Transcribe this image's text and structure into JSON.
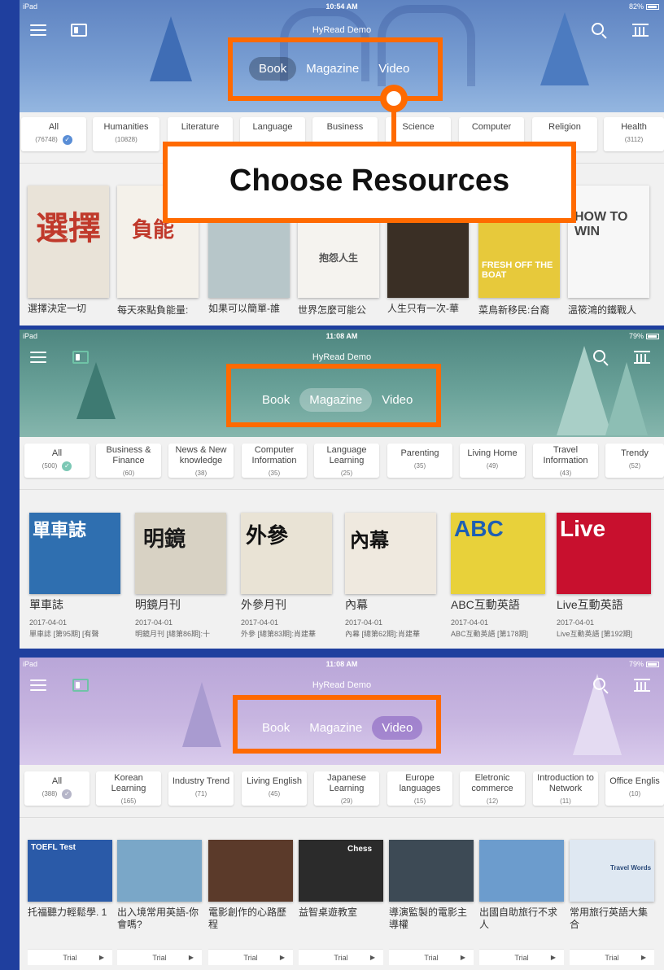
{
  "colors": {
    "accent": "#ff6a00",
    "background": "#1f3f9e"
  },
  "callout": {
    "label": "Choose Resources"
  },
  "panels": [
    {
      "status": {
        "left": "iPad",
        "time": "10:54 AM",
        "battery": "82%"
      },
      "app_name": "HyRead Demo",
      "tabs": [
        "Book",
        "Magazine",
        "Video"
      ],
      "active_tab": "Book",
      "categories": [
        {
          "label": "All",
          "count": "(76748)"
        },
        {
          "label": "Humanities",
          "count": "(10828)"
        },
        {
          "label": "Literature",
          "count": ""
        },
        {
          "label": "Language",
          "count": ""
        },
        {
          "label": "Business",
          "count": ""
        },
        {
          "label": "Science",
          "count": ""
        },
        {
          "label": "Computer",
          "count": ""
        },
        {
          "label": "Religion",
          "count": ""
        },
        {
          "label": "Health",
          "count": "(3112)"
        }
      ],
      "items": [
        {
          "title": "選擇決定一切",
          "cover_text": "選擇",
          "cover_color": "#e9e3d8",
          "text_color": "#c0392b"
        },
        {
          "title": "每天來點負能量:",
          "cover_text": "負能",
          "cover_color": "#f4f1ea",
          "text_color": "#c0392b"
        },
        {
          "title": "如果可以簡單-誰",
          "cover_text": "",
          "cover_color": "#b7c6c9",
          "text_color": "#fff"
        },
        {
          "title": "世界怎麼可能公",
          "cover_text": "抱怨人生",
          "cover_color": "#f5f3ef",
          "text_color": "#555"
        },
        {
          "title": "人生只有一次-華",
          "cover_text": "",
          "cover_color": "#3a2f25",
          "text_color": "#e6c25a"
        },
        {
          "title": "菜鳥新移民:台裔",
          "cover_text": "FRESH OFF THE BOAT",
          "cover_color": "#e7c93b",
          "text_color": "#fff"
        },
        {
          "title": "溫筱鴻的鐵戰人",
          "cover_text": "HOW TO WIN",
          "cover_color": "#f7f7f7",
          "text_color": "#444"
        }
      ]
    },
    {
      "status": {
        "left": "iPad",
        "time": "11:08 AM",
        "battery": "79%"
      },
      "app_name": "HyRead Demo",
      "tabs": [
        "Book",
        "Magazine",
        "Video"
      ],
      "active_tab": "Magazine",
      "categories": [
        {
          "label": "All",
          "count": "(500)"
        },
        {
          "label": "Business & Finance",
          "count": "(60)"
        },
        {
          "label": "News & New knowledge",
          "count": "(38)"
        },
        {
          "label": "Computer Information",
          "count": "(35)"
        },
        {
          "label": "Language Learning",
          "count": "(25)"
        },
        {
          "label": "Parenting",
          "count": "(35)"
        },
        {
          "label": "Living Home",
          "count": "(49)"
        },
        {
          "label": "Travel Information",
          "count": "(43)"
        },
        {
          "label": "Trendy",
          "count": "(52)"
        }
      ],
      "items": [
        {
          "title": "單車誌",
          "date": "2017-04-01",
          "issue": "單車誌 [第95期] [有聲",
          "cover_text": "單車誌",
          "cover_color": "#2f6fb0",
          "text_color": "#fff"
        },
        {
          "title": "明鏡月刊",
          "date": "2017-04-01",
          "issue": "明鏡月刊 [總第86期]:十",
          "cover_text": "明鏡",
          "cover_color": "#d8d2c4",
          "text_color": "#1a1a1a"
        },
        {
          "title": "外參月刊",
          "date": "2017-04-01",
          "issue": "外參 [總第83期]:肖建華",
          "cover_text": "外參",
          "cover_color": "#e9e3d5",
          "text_color": "#111"
        },
        {
          "title": "內幕",
          "date": "2017-04-01",
          "issue": "內幕 [總第62期]:肖建華",
          "cover_text": "內幕",
          "cover_color": "#efe9df",
          "text_color": "#111"
        },
        {
          "title": "ABC互動英語",
          "date": "2017-04-01",
          "issue": "ABC互動英語 [第178期]",
          "cover_text": "ABC",
          "cover_color": "#e8d13a",
          "text_color": "#1e5fb3"
        },
        {
          "title": "Live互動英語",
          "date": "2017-04-01",
          "issue": "Live互動英語 [第192期]",
          "cover_text": "Live",
          "cover_color": "#c8102e",
          "text_color": "#fff"
        }
      ]
    },
    {
      "status": {
        "left": "iPad",
        "time": "11:08 AM",
        "battery": "79%"
      },
      "app_name": "HyRead Demo",
      "tabs": [
        "Book",
        "Magazine",
        "Video"
      ],
      "active_tab": "Video",
      "categories": [
        {
          "label": "All",
          "count": "(388)"
        },
        {
          "label": "Korean Learning",
          "count": "(165)"
        },
        {
          "label": "Industry Trend",
          "count": "(71)"
        },
        {
          "label": "Living English",
          "count": "(45)"
        },
        {
          "label": "Japanese Learning",
          "count": "(29)"
        },
        {
          "label": "Europe languages",
          "count": "(15)"
        },
        {
          "label": "Eletronic commerce",
          "count": "(12)"
        },
        {
          "label": "Introduction to Network",
          "count": "(11)"
        },
        {
          "label": "Office Englis",
          "count": "(10)"
        }
      ],
      "items": [
        {
          "title": "托福聽力輕鬆學. 1",
          "trial": "Trial",
          "cover_text": "TOEFL Test",
          "cover_color": "#2a5aa8",
          "text_color": "#fff"
        },
        {
          "title": "出入境常用英語-你會嗎?",
          "trial": "Trial",
          "cover_text": "",
          "cover_color": "#7aa7c8",
          "text_color": "#fff"
        },
        {
          "title": "電影創作的心路歷程",
          "trial": "Trial",
          "cover_text": "",
          "cover_color": "#5b3a2a",
          "text_color": "#fff"
        },
        {
          "title": "益智桌遊教室",
          "trial": "Trial",
          "cover_text": "Chess",
          "cover_color": "#2b2b2b",
          "text_color": "#fff"
        },
        {
          "title": "導演監製的電影主導權",
          "trial": "Trial",
          "cover_text": "",
          "cover_color": "#3d4a55",
          "text_color": "#fff"
        },
        {
          "title": "出國自助旅行不求人",
          "trial": "Trial",
          "cover_text": "",
          "cover_color": "#6c9ccd",
          "text_color": "#fff"
        },
        {
          "title": "常用旅行英語大集合",
          "trial": "Trial",
          "cover_text": "Travel Words",
          "cover_color": "#dfe8f2",
          "text_color": "#2a4a7a"
        }
      ]
    }
  ]
}
